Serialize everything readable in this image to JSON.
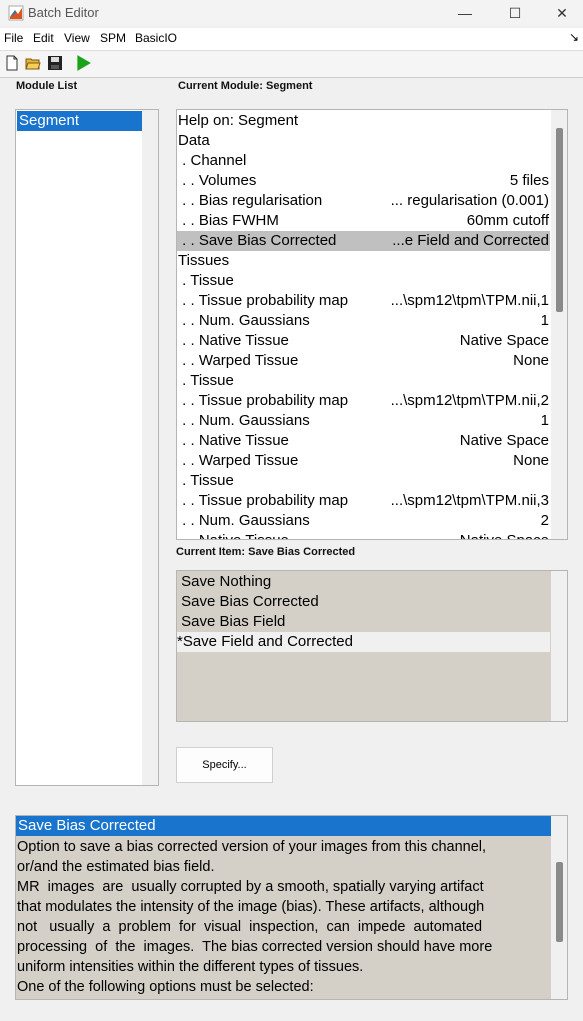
{
  "window": {
    "title": "Batch Editor",
    "minimize_glyph": "—",
    "maximize_glyph": "☐",
    "close_glyph": "✕"
  },
  "menu": {
    "items": [
      "File",
      "Edit",
      "View",
      "SPM",
      "BasicIO"
    ],
    "overflow_glyph": "↘"
  },
  "toolbar": {
    "icons": [
      "new-file-icon",
      "open-folder-icon",
      "save-disk-icon",
      "run-play-icon"
    ],
    "run_color": "#1aa31a"
  },
  "module_list": {
    "label": "Module List",
    "items": [
      "Segment"
    ],
    "selected": 0
  },
  "current_module": {
    "label": "Current Module: Segment",
    "rows": [
      {
        "k": "Help on: Segment",
        "v": ""
      },
      {
        "k": "Data",
        "v": ""
      },
      {
        "k": " . Channel",
        "v": ""
      },
      {
        "k": " . . Volumes",
        "v": "5 files"
      },
      {
        "k": " . . Bias regularisation",
        "v": "... regularisation (0.001)"
      },
      {
        "k": " . . Bias FWHM",
        "v": "60mm cutoff"
      },
      {
        "k": " . . Save Bias Corrected",
        "v": "...e Field and Corrected",
        "selected": true
      },
      {
        "k": "Tissues",
        "v": ""
      },
      {
        "k": " . Tissue",
        "v": ""
      },
      {
        "k": " . . Tissue probability map",
        "v": "...\\spm12\\tpm\\TPM.nii,1"
      },
      {
        "k": " . . Num. Gaussians",
        "v": "1"
      },
      {
        "k": " . . Native Tissue",
        "v": "Native Space"
      },
      {
        "k": " . . Warped Tissue",
        "v": "None"
      },
      {
        "k": " . Tissue",
        "v": ""
      },
      {
        "k": " . . Tissue probability map",
        "v": "...\\spm12\\tpm\\TPM.nii,2"
      },
      {
        "k": " . . Num. Gaussians",
        "v": "1"
      },
      {
        "k": " . . Native Tissue",
        "v": "Native Space"
      },
      {
        "k": " . . Warped Tissue",
        "v": "None"
      },
      {
        "k": " . Tissue",
        "v": ""
      },
      {
        "k": " . . Tissue probability map",
        "v": "...\\spm12\\tpm\\TPM.nii,3"
      },
      {
        "k": " . . Num. Gaussians",
        "v": "2"
      },
      {
        "k": " . . Native Tissue",
        "v": "Native Space"
      }
    ]
  },
  "current_item": {
    "label": "Current Item: Save Bias Corrected",
    "options": [
      " Save Nothing",
      " Save Bias Corrected",
      " Save Bias Field",
      "*Save Field and Corrected"
    ],
    "selected": 3
  },
  "specify_button": "Specify...",
  "help": {
    "title": "Save Bias Corrected",
    "lines": [
      "Option to save a bias corrected version of your images from this channel,",
      "or/and the estimated bias field.",
      "MR  images  are  usually corrupted by a smooth, spatially varying artifact",
      "that modulates the intensity of the image (bias). These artifacts, although",
      "not   usually  a  problem  for  visual  inspection,  can  impede  automated",
      "processing  of  the  images.  The bias corrected version should have more",
      "uniform intensities within the different types of tissues.",
      "One of the following options must be selected:"
    ]
  }
}
